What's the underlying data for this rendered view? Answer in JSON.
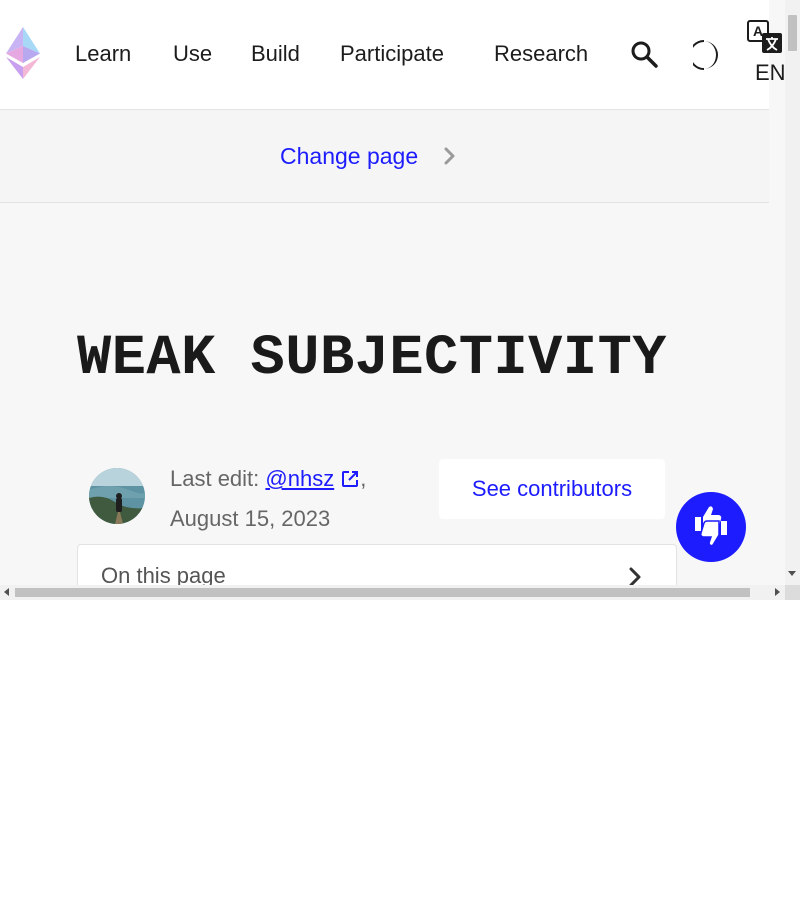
{
  "nav": {
    "items": [
      {
        "label": "Learn"
      },
      {
        "label": "Use"
      },
      {
        "label": "Build"
      },
      {
        "label": "Participate"
      },
      {
        "label": "Research"
      }
    ],
    "language_label": "EN",
    "icons": {
      "logo": "ethereum-logo",
      "search": "search-icon",
      "theme": "dark-mode-icon",
      "language": "translate-icon"
    }
  },
  "change_page": {
    "label": "Change page",
    "icon": "chevron-right-icon"
  },
  "page": {
    "title": "WEAK SUBJECTIVITY"
  },
  "meta": {
    "last_edit_label": "Last edit:",
    "author": "@nhsz",
    "author_suffix": ",",
    "date": "August 15, 2023",
    "author_icon": "external-link-icon"
  },
  "contributors_button": {
    "label": "See contributors"
  },
  "toc": {
    "label": "On this page",
    "icon": "chevron-right-icon"
  },
  "feedback": {
    "icon": "thumbs-up-down-icon"
  },
  "colors": {
    "accent": "#1c1cff",
    "background": "#f7f7f7",
    "text": "#1a1a1a"
  }
}
